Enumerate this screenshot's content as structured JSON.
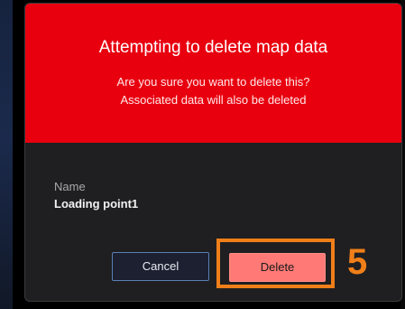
{
  "dialog": {
    "title": "Attempting to delete map data",
    "message_line1": "Are you sure you want to delete this?",
    "message_line2": "Associated data will also be deleted",
    "field_label": "Name",
    "field_value": "Loading point1",
    "cancel_label": "Cancel",
    "delete_label": "Delete"
  },
  "annotation": {
    "step_number": "5"
  },
  "colors": {
    "header": "#e8000f",
    "body": "#1f1f21",
    "delete_button": "#ff7a76",
    "cancel_border": "#5a7fb5",
    "annotation": "#f07f19"
  }
}
